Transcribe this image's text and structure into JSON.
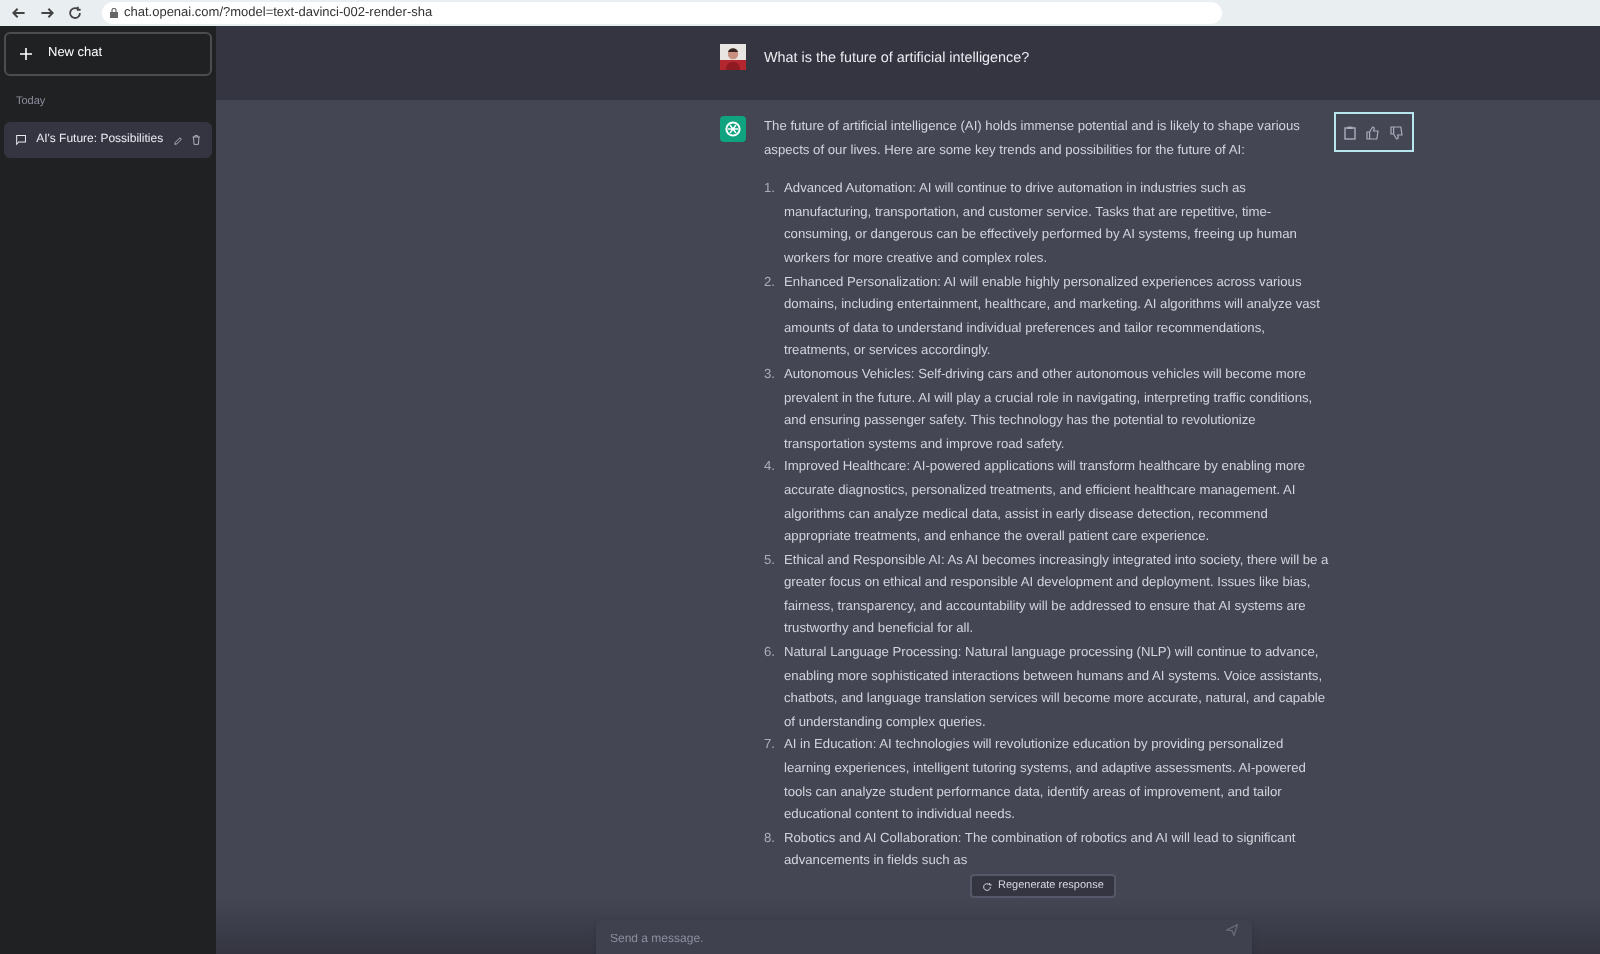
{
  "browser": {
    "url": "chat.openai.com/?model=text-davinci-002-render-sha"
  },
  "sidebar": {
    "new_chat": "New chat",
    "section": "Today",
    "chats": [
      {
        "title": "AI's Future: Possibilities",
        "selected": true
      }
    ]
  },
  "user_message": "What is the future of artificial intelligence?",
  "answer": {
    "intro": "The future of artificial intelligence (AI) holds immense potential and is likely to shape various aspects of our lives. Here are some key trends and possibilities for the future of AI:",
    "items": [
      {
        "number": "1.",
        "text": "Advanced Automation: AI will continue to drive automation in industries such as manufacturing, transportation, and customer service. Tasks that are repetitive, time-consuming, or dangerous can be effectively performed by AI systems, freeing up human workers for more creative and complex roles."
      },
      {
        "number": "2.",
        "text": "Enhanced Personalization: AI will enable highly personalized experiences across various domains, including entertainment, healthcare, and marketing. AI algorithms will analyze vast amounts of data to understand individual preferences and tailor recommendations, treatments, or services accordingly."
      },
      {
        "number": "3.",
        "text": "Autonomous Vehicles: Self-driving cars and other autonomous vehicles will become more prevalent in the future. AI will play a crucial role in navigating, interpreting traffic conditions, and ensuring passenger safety. This technology has the potential to revolutionize transportation systems and improve road safety."
      },
      {
        "number": "4.",
        "text": "Improved Healthcare: AI-powered applications will transform healthcare by enabling more accurate diagnostics, personalized treatments, and efficient healthcare management. AI algorithms can analyze medical data, assist in early disease detection, recommend appropriate treatments, and enhance the overall patient care experience."
      },
      {
        "number": "5.",
        "text": "Ethical and Responsible AI: As AI becomes increasingly integrated into society, there will be a greater focus on ethical and responsible AI development and deployment. Issues like bias, fairness, transparency, and accountability will be addressed to ensure that AI systems are trustworthy and beneficial for all."
      },
      {
        "number": "6.",
        "text": "Natural Language Processing: Natural language processing (NLP) will continue to advance, enabling more sophisticated interactions between humans and AI systems. Voice assistants, chatbots, and language translation services will become more accurate, natural, and capable of understanding complex queries."
      },
      {
        "number": "7.",
        "text": "AI in Education: AI technologies will revolutionize education by providing personalized learning experiences, intelligent tutoring systems, and adaptive assessments. AI-powered tools can analyze student performance data, identify areas of improvement, and tailor educational content to individual needs."
      },
      {
        "number": "8.",
        "text": "Robotics and AI Collaboration: The combination of robotics and AI will lead to significant advancements in fields such as"
      }
    ]
  },
  "regenerate": "Regenerate response",
  "composer": {
    "placeholder": "Send a message."
  }
}
